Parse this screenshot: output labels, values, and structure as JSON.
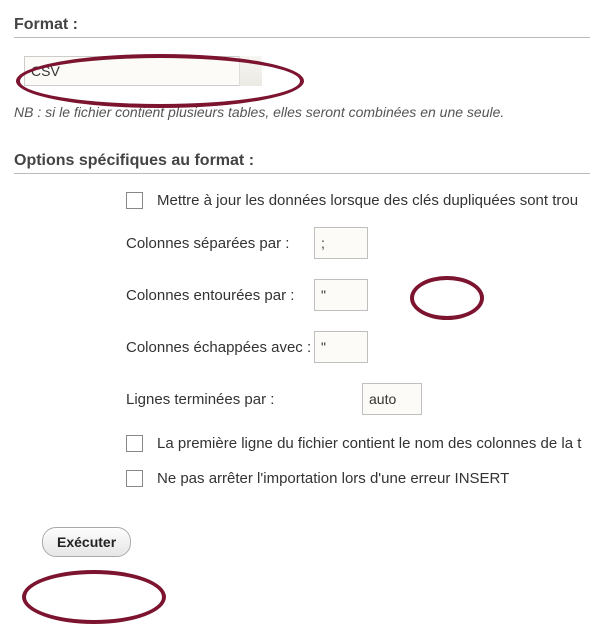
{
  "format": {
    "title": "Format :",
    "selected": "CSV",
    "note": "NB : si le fichier contient plusieurs tables, elles seront combinées en une seule."
  },
  "options": {
    "title": "Options spécifiques au format :",
    "update_dup_label": "Mettre à jour les données lorsque des clés dupliquées sont trou",
    "separated_label": "Colonnes séparées par :",
    "separated_value": ";",
    "enclosed_label": "Colonnes entourées par :",
    "enclosed_value": "\"",
    "escaped_label": "Colonnes échappées avec :",
    "escaped_value": "\"",
    "terminated_label": "Lignes terminées par :",
    "terminated_value": "auto",
    "first_line_label": "La première ligne du fichier contient le nom des colonnes de la t",
    "no_stop_label": "Ne pas arrêter l'importation lors d'une erreur INSERT"
  },
  "execute_label": "Exécuter"
}
